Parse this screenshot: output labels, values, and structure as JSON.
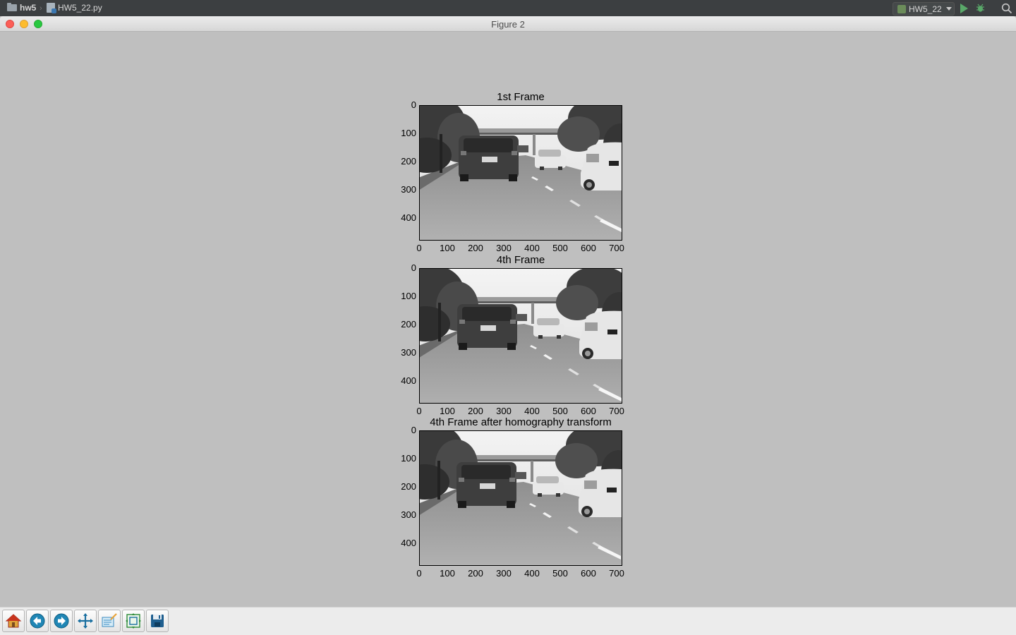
{
  "ide": {
    "project": "hw5",
    "file": "HW5_22.py",
    "run_config": "HW5_22"
  },
  "window": {
    "title": "Figure 2"
  },
  "subplots": [
    {
      "title": "1st Frame"
    },
    {
      "title": "4th Frame"
    },
    {
      "title": "4th Frame after homography transform"
    }
  ],
  "axes": {
    "x_ticks": [
      "0",
      "100",
      "200",
      "300",
      "400",
      "500",
      "600",
      "700"
    ],
    "y_ticks": [
      "0",
      "100",
      "200",
      "300",
      "400"
    ]
  },
  "toolbar": {
    "buttons": [
      {
        "name": "home-icon"
      },
      {
        "name": "back-icon"
      },
      {
        "name": "forward-icon"
      },
      {
        "name": "pan-icon"
      },
      {
        "name": "zoom-icon"
      },
      {
        "name": "configure-subplots-icon"
      },
      {
        "name": "save-icon"
      }
    ]
  }
}
